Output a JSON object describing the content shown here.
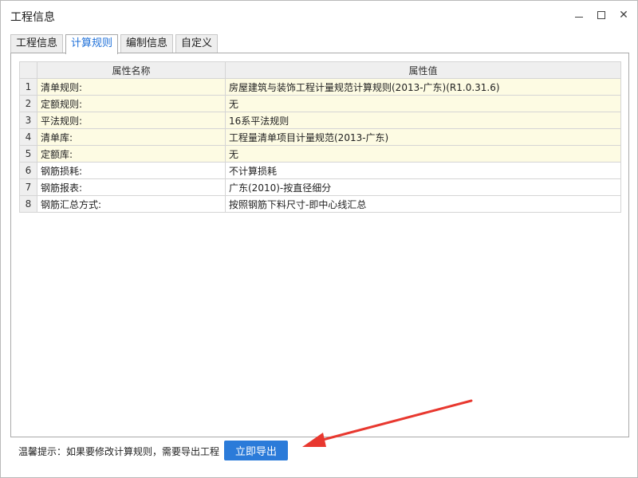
{
  "window": {
    "title": "工程信息"
  },
  "tabs": [
    {
      "label": "工程信息"
    },
    {
      "label": "计算规则"
    },
    {
      "label": "编制信息"
    },
    {
      "label": "自定义"
    }
  ],
  "active_tab": "计算规则",
  "table": {
    "headers": {
      "index": "",
      "name": "属性名称",
      "value": "属性值"
    },
    "rows": [
      {
        "index": "1",
        "name": "清单规则:",
        "value": "房屋建筑与装饰工程计量规范计算规则(2013-广东)(R1.0.31.6)",
        "highlighted": true
      },
      {
        "index": "2",
        "name": "定额规则:",
        "value": "无",
        "highlighted": true
      },
      {
        "index": "3",
        "name": "平法规则:",
        "value": "16系平法规则",
        "highlighted": true
      },
      {
        "index": "4",
        "name": "清单库:",
        "value": "工程量清单项目计量规范(2013-广东)",
        "highlighted": true
      },
      {
        "index": "5",
        "name": "定额库:",
        "value": "无",
        "highlighted": true
      },
      {
        "index": "6",
        "name": "钢筋损耗:",
        "value": "不计算损耗",
        "highlighted": false
      },
      {
        "index": "7",
        "name": "钢筋报表:",
        "value": "广东(2010)-按直径细分",
        "highlighted": false
      },
      {
        "index": "8",
        "name": "钢筋汇总方式:",
        "value": "按照钢筋下料尺寸-即中心线汇总",
        "highlighted": false
      }
    ]
  },
  "footer": {
    "tip": "温馨提示：如果要修改计算规则，需要导出工程",
    "export_label": "立即导出"
  },
  "colors": {
    "accent": "#2b7bd9",
    "highlight_row": "#fdfbe3",
    "arrow": "#e8382f"
  }
}
